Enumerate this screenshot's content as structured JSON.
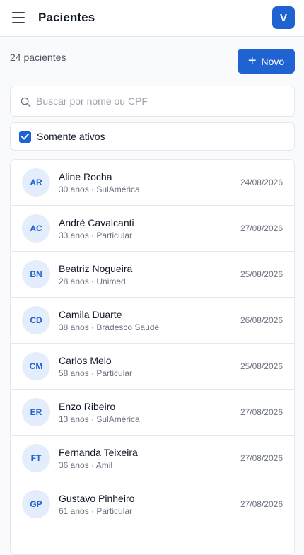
{
  "header": {
    "title": "Pacientes",
    "user_initial": "V"
  },
  "toolbar": {
    "count_text": "24 pacientes",
    "new_label": "Novo",
    "new_icon": "plus-icon"
  },
  "search": {
    "placeholder": "Buscar por nome ou CPF",
    "value": ""
  },
  "filter": {
    "label": "Somente ativos",
    "checked": true
  },
  "colors": {
    "accent": "#1e63d1",
    "avatar_bg": "#e3edfb"
  },
  "patients": [
    {
      "initials": "AR",
      "name": "Aline Rocha",
      "meta": "30 anos · SulAmérica",
      "date": "24/08/2026"
    },
    {
      "initials": "AC",
      "name": "André Cavalcanti",
      "meta": "33 anos · Particular",
      "date": "27/08/2026"
    },
    {
      "initials": "BN",
      "name": "Beatriz Nogueira",
      "meta": "28 anos · Unimed",
      "date": "25/08/2026"
    },
    {
      "initials": "CD",
      "name": "Camila Duarte",
      "meta": "38 anos · Bradesco Saúde",
      "date": "26/08/2026"
    },
    {
      "initials": "CM",
      "name": "Carlos Melo",
      "meta": "58 anos · Particular",
      "date": "25/08/2026"
    },
    {
      "initials": "ER",
      "name": "Enzo Ribeiro",
      "meta": "13 anos · SulAmérica",
      "date": "27/08/2026"
    },
    {
      "initials": "FT",
      "name": "Fernanda Teixeira",
      "meta": "36 anos · Amil",
      "date": "27/08/2026"
    },
    {
      "initials": "GP",
      "name": "Gustavo Pinheiro",
      "meta": "61 anos · Particular",
      "date": "27/08/2026"
    }
  ]
}
